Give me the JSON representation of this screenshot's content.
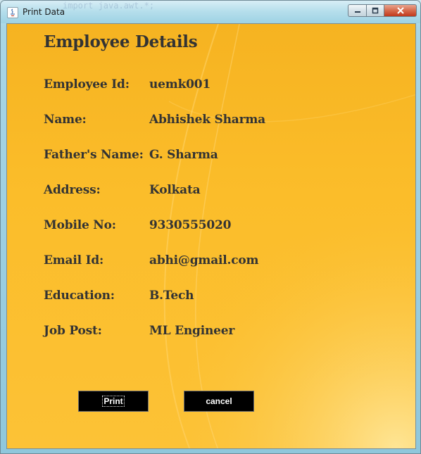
{
  "window": {
    "title": "Print Data",
    "background_code_hint": "import java.awt.*;"
  },
  "colors": {
    "panel_background": "#fbbd2a",
    "button_background": "#000000",
    "text": "#333333"
  },
  "form": {
    "heading": "Employee Details",
    "fields": [
      {
        "label": "Employee Id:",
        "value": "uemk001"
      },
      {
        "label": "Name:",
        "value": "Abhishek Sharma"
      },
      {
        "label": "Father's Name:",
        "value": "G. Sharma"
      },
      {
        "label": "Address:",
        "value": "Kolkata"
      },
      {
        "label": "Mobile No:",
        "value": "9330555020"
      },
      {
        "label": "Email Id:",
        "value": "abhi@gmail.com"
      },
      {
        "label": "Education:",
        "value": "B.Tech"
      },
      {
        "label": "Job Post:",
        "value": "ML Engineer"
      }
    ]
  },
  "buttons": {
    "print_label": "Print",
    "cancel_label": "cancel"
  }
}
